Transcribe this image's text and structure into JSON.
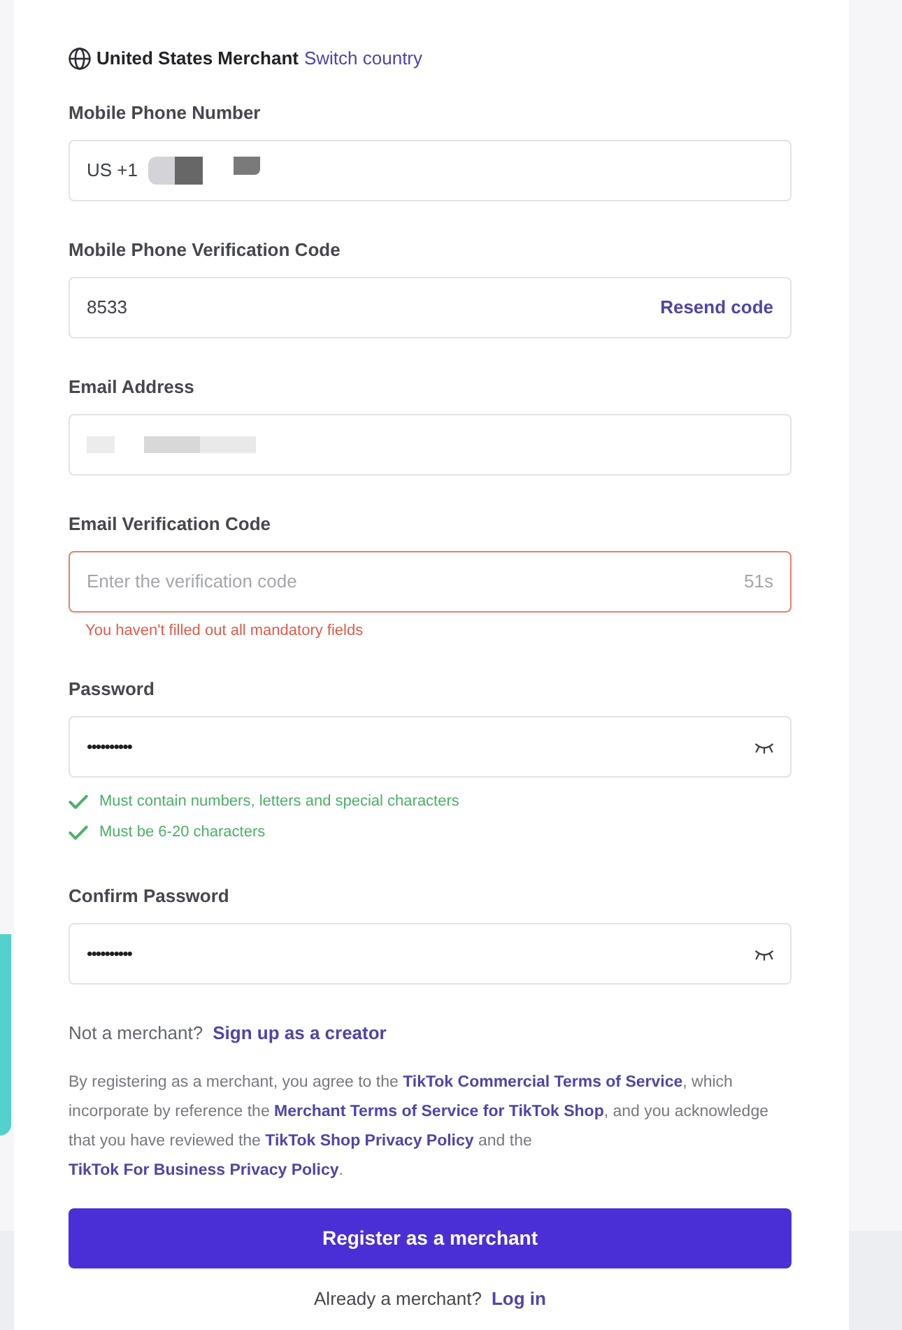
{
  "header": {
    "label": "United States Merchant",
    "link": "Switch country"
  },
  "fields": [
    {
      "kind": "phone",
      "label": "Mobile Phone Number",
      "value": "US +1",
      "redacted": true
    },
    {
      "kind": "code",
      "label": "Mobile Phone Verification Code",
      "value": "8533",
      "action": "Resend code"
    },
    {
      "kind": "email",
      "label": "Email Address",
      "redacted": true
    },
    {
      "kind": "code",
      "label": "Email Verification Code",
      "placeholder": "Enter the verification code",
      "countdown": "51s",
      "error": "You haven't filled out all mandatory fields"
    },
    {
      "kind": "password",
      "label": "Password",
      "value": "••••••••••",
      "masked": true,
      "rules": [
        {
          "text": "Must contain numbers, letters and special characters",
          "met": true
        },
        {
          "text": "Must be 6-20 characters",
          "met": true
        }
      ]
    },
    {
      "kind": "password",
      "label": "Confirm Password",
      "value": "••••••••••",
      "masked": true
    }
  ],
  "creator_prompt": {
    "text": "Not a merchant?",
    "link": "Sign up as a creator"
  },
  "agreement": [
    {
      "kind": "text",
      "text": "By registering as a merchant, you agree to the "
    },
    {
      "kind": "link",
      "text": "TikTok Commercial Terms of Service"
    },
    {
      "kind": "text",
      "text": ", which incorporate by reference the "
    },
    {
      "kind": "link",
      "text": "Merchant Terms of Service for TikTok Shop"
    },
    {
      "kind": "text",
      "text": ", and you acknowledge that you have reviewed the "
    },
    {
      "kind": "link",
      "text": "TikTok Shop Privacy Policy"
    },
    {
      "kind": "text",
      "text": " and the "
    },
    {
      "kind": "link",
      "text": "TikTok For Business Privacy Policy"
    },
    {
      "kind": "text",
      "text": "."
    }
  ],
  "submit_button": "Register as a merchant",
  "login_prompt": {
    "text": "Already a merchant?",
    "link": "Log in"
  }
}
